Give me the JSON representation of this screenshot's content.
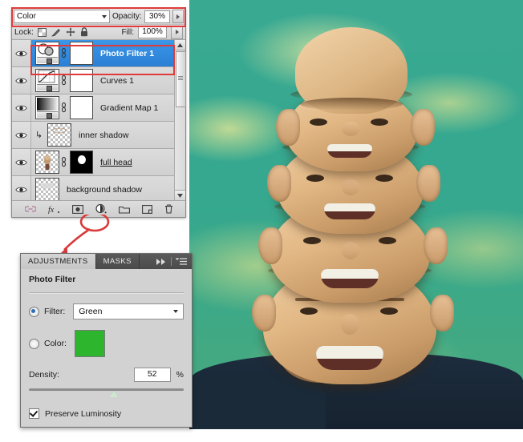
{
  "layers_panel": {
    "blend_mode": "Color",
    "opacity_label": "Opacity:",
    "opacity_value": "30%",
    "lock_label": "Lock:",
    "fill_label": "Fill:",
    "fill_value": "100%",
    "lock_icons": [
      "transparency-lock-icon",
      "paint-lock-icon",
      "move-lock-icon",
      "lock-all-icon"
    ],
    "layers": [
      {
        "name": "Photo Filter 1",
        "selected": true,
        "underlined": false,
        "clipped": false,
        "type": "adjustment-photo-filter",
        "has_mask": true,
        "has_chain": true,
        "visible": true
      },
      {
        "name": "Curves 1",
        "selected": false,
        "underlined": false,
        "clipped": false,
        "type": "adjustment-curves",
        "has_mask": true,
        "has_chain": true,
        "visible": true
      },
      {
        "name": "Gradient Map 1",
        "selected": false,
        "underlined": false,
        "clipped": false,
        "type": "adjustment-gradient-map",
        "has_mask": true,
        "has_chain": true,
        "visible": true
      },
      {
        "name": "inner shadow",
        "selected": false,
        "underlined": false,
        "clipped": true,
        "type": "pixel",
        "has_mask": false,
        "has_chain": false,
        "visible": true
      },
      {
        "name": "full head",
        "selected": false,
        "underlined": true,
        "clipped": false,
        "type": "pixel-head",
        "has_mask": true,
        "has_chain": true,
        "visible": true
      },
      {
        "name": "background shadow",
        "selected": false,
        "underlined": false,
        "clipped": false,
        "type": "pixel",
        "has_mask": false,
        "has_chain": false,
        "visible": true
      }
    ],
    "bottom_buttons": [
      "link-layers-icon",
      "layer-style-fx-icon",
      "add-layer-mask-icon",
      "new-adjustment-layer-icon",
      "new-group-icon",
      "new-layer-icon",
      "delete-layer-icon"
    ],
    "highlight_color": "#e03a3a"
  },
  "adjustments_panel": {
    "tabs": [
      {
        "label": "ADJUSTMENTS",
        "active": true
      },
      {
        "label": "MASKS",
        "active": false
      }
    ],
    "tab_icons": [
      "collapse-to-icons-icon",
      "panel-menu-icon"
    ],
    "title": "Photo Filter",
    "filter_radio_label": "Filter:",
    "filter_selected": true,
    "filter_value": "Green",
    "color_radio_label": "Color:",
    "color_selected": false,
    "color_swatch": "#2db52d",
    "density_label": "Density:",
    "density_value": "52",
    "density_unit": "%",
    "preserve_luminosity_label": "Preserve Luminosity",
    "preserve_luminosity_checked": true
  },
  "annotation": {
    "arrow_name": "red-arrow-annotation",
    "circle_name": "red-circle-annotation",
    "color": "#e03a3a"
  }
}
